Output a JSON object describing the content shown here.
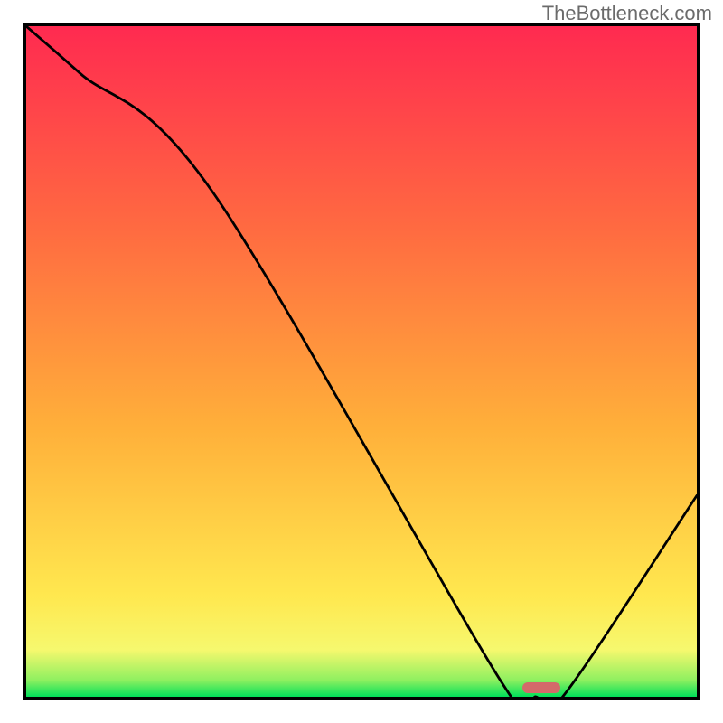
{
  "watermark": "TheBottleneck.com",
  "chart_data": {
    "type": "line",
    "title": "",
    "xlabel": "",
    "ylabel": "",
    "xlim": [
      0,
      100
    ],
    "ylim": [
      0,
      100
    ],
    "grid": false,
    "legend": false,
    "series": [
      {
        "name": "bottleneck-curve",
        "x": [
          0,
          8,
          28,
          71,
          76,
          80,
          100
        ],
        "y": [
          100,
          93,
          75,
          2,
          0,
          0,
          30
        ]
      }
    ],
    "annotations": [
      {
        "name": "optimal-marker",
        "x": 76.8,
        "y": 1.3,
        "color": "#d46a6a",
        "shape": "pill"
      }
    ],
    "background": {
      "type": "vertical-gradient",
      "stops": [
        {
          "y": 0,
          "color": "#00e05a"
        },
        {
          "y": 2.5,
          "color": "#8ff060"
        },
        {
          "y": 7,
          "color": "#f6f86e"
        },
        {
          "y": 15,
          "color": "#ffe84f"
        },
        {
          "y": 40,
          "color": "#ffb03a"
        },
        {
          "y": 70,
          "color": "#ff6a41"
        },
        {
          "y": 100,
          "color": "#ff2a50"
        }
      ]
    }
  }
}
